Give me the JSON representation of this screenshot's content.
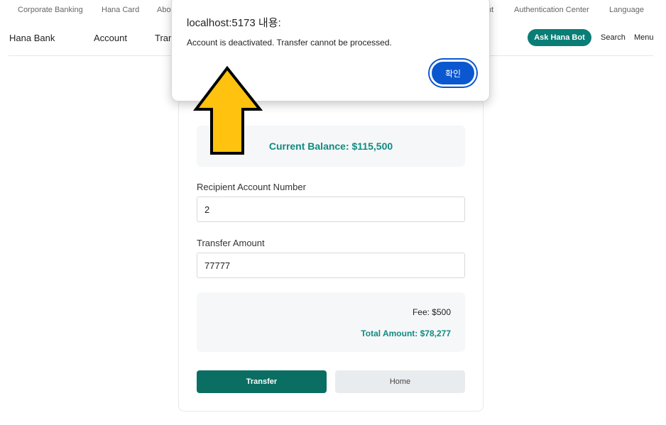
{
  "utility_bar": {
    "links": [
      "Corporate Banking",
      "Hana Card",
      "Abo",
      "ut",
      "Authentication Center",
      "Language"
    ]
  },
  "nav": {
    "brand": "Hana Bank",
    "links": [
      "Account",
      "Tran"
    ],
    "bot_button": "Ask Hana Bot",
    "search": "Search",
    "menu": "Menu"
  },
  "transfer": {
    "balance": "Current Balance: $115,500",
    "recipient_label": "Recipient Account Number",
    "recipient_value": "2",
    "amount_label": "Transfer Amount",
    "amount_value": "77777",
    "fee": "Fee: $500",
    "total": "Total Amount: $78,277",
    "transfer_button": "Transfer",
    "home_button": "Home"
  },
  "dialog": {
    "title": "localhost:5173 내용:",
    "message": "Account is deactivated. Transfer cannot be processed.",
    "ok_button": "확인"
  },
  "colors": {
    "accent_teal": "#0a7e76",
    "transfer_button": "#0b6e62",
    "dialog_ok": "#0b57d0",
    "annotation_arrow": "#ffc20e"
  },
  "icons": {
    "annotation": "up-arrow-icon"
  }
}
